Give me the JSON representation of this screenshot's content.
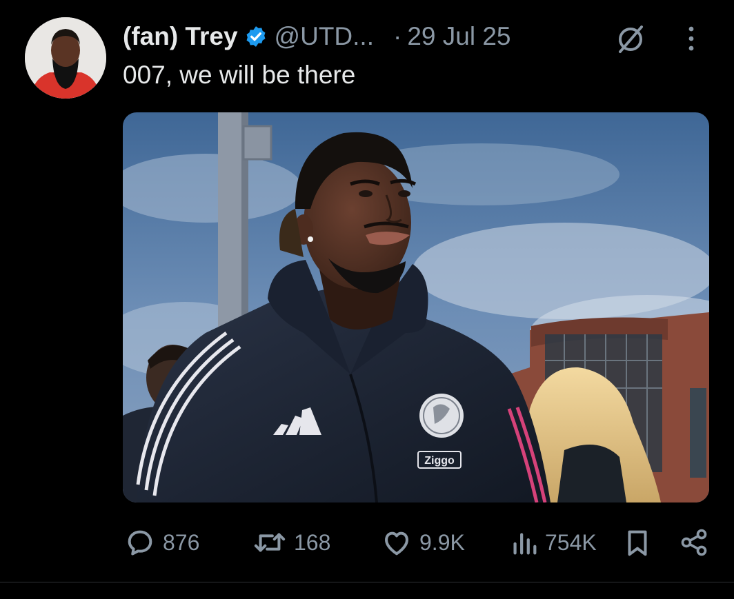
{
  "post": {
    "display_name": "(fan) Trey",
    "handle": "@UTD...",
    "separator": "·",
    "date": "29 Jul 25",
    "text": "007, we will be there",
    "media": {
      "jacket_logo_text": "Ziggo"
    }
  },
  "actions": {
    "replies": "876",
    "reposts": "168",
    "likes": "9.9K",
    "views": "754K"
  },
  "colors": {
    "background": "#000000",
    "text_primary": "#e7e9ea",
    "text_secondary": "#8b98a5",
    "verified": "#1d9bf0"
  },
  "icons": [
    "verified-badge-icon",
    "grok-icon",
    "more-options-icon",
    "reply-icon",
    "repost-icon",
    "like-icon",
    "views-icon",
    "bookmark-icon",
    "share-icon"
  ]
}
